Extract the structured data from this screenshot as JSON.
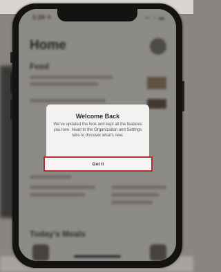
{
  "status": {
    "time": "1:24 ✈",
    "icons": "▪▪ ◔ ▬"
  },
  "home": {
    "title": "Home",
    "feed_label": "Feed",
    "todays_meals_label": "Today's Meals"
  },
  "dialog": {
    "title": "Welcome Back",
    "message": "We've updated the look and kept all the features you love. Head to the Organization and Settings tabs to discover what's new.",
    "button_label": "Got It"
  },
  "colors": {
    "highlight_border": "#b22e34",
    "dialog_background": "#f3f2f0"
  }
}
